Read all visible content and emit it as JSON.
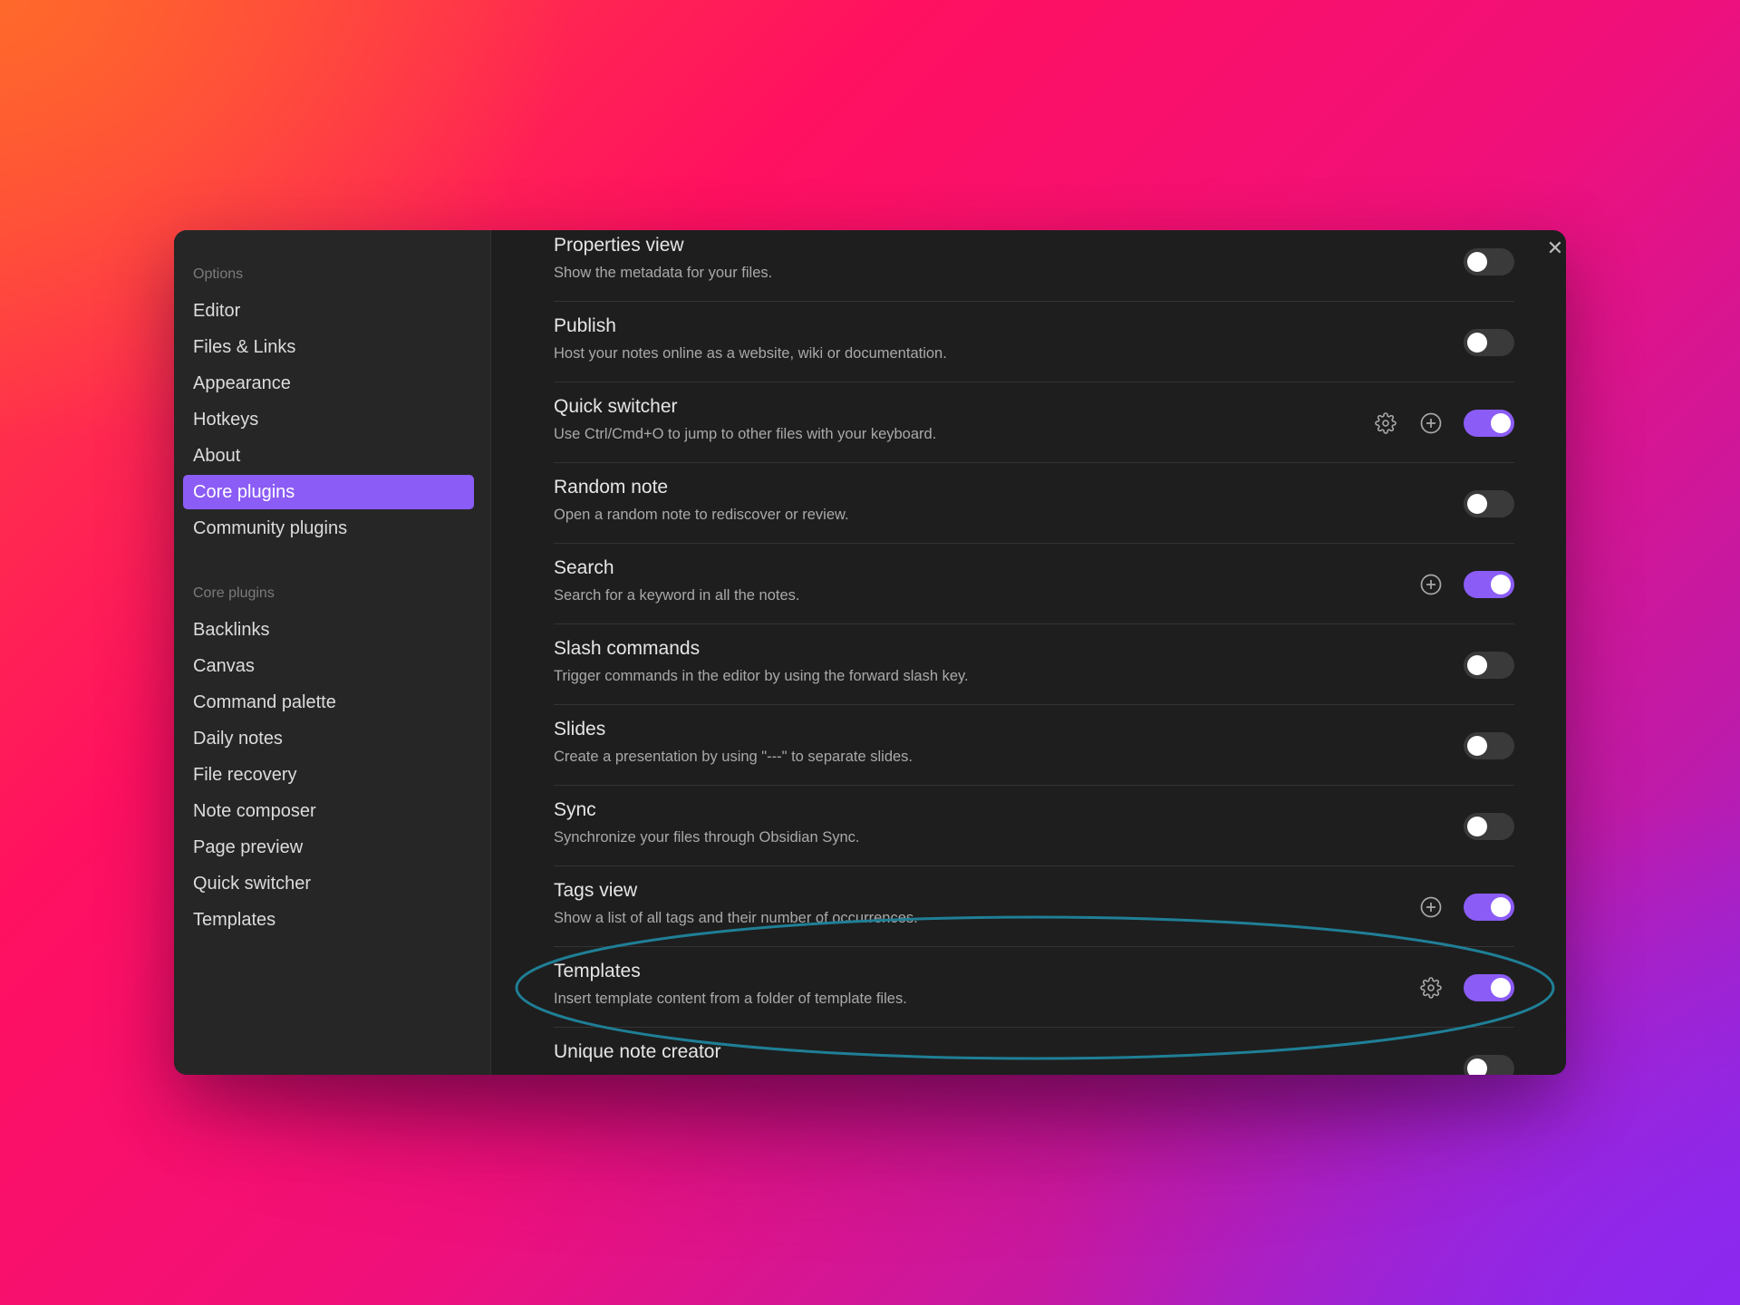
{
  "sidebar": {
    "options_heading": "Options",
    "options_items": [
      {
        "label": "Editor",
        "active": false
      },
      {
        "label": "Files & Links",
        "active": false
      },
      {
        "label": "Appearance",
        "active": false
      },
      {
        "label": "Hotkeys",
        "active": false
      },
      {
        "label": "About",
        "active": false
      },
      {
        "label": "Core plugins",
        "active": true
      },
      {
        "label": "Community plugins",
        "active": false
      }
    ],
    "core_heading": "Core plugins",
    "core_items": [
      {
        "label": "Backlinks"
      },
      {
        "label": "Canvas"
      },
      {
        "label": "Command palette"
      },
      {
        "label": "Daily notes"
      },
      {
        "label": "File recovery"
      },
      {
        "label": "Note composer"
      },
      {
        "label": "Page preview"
      },
      {
        "label": "Quick switcher"
      },
      {
        "label": "Templates"
      }
    ]
  },
  "plugins": [
    {
      "title": "Properties view",
      "description": "Show the metadata for your files.",
      "enabled": false,
      "settings": false,
      "hotkey": false
    },
    {
      "title": "Publish",
      "description": "Host your notes online as a website, wiki or documentation.",
      "enabled": false,
      "settings": false,
      "hotkey": false
    },
    {
      "title": "Quick switcher",
      "description": "Use Ctrl/Cmd+O to jump to other files with your keyboard.",
      "enabled": true,
      "settings": true,
      "hotkey": true
    },
    {
      "title": "Random note",
      "description": "Open a random note to rediscover or review.",
      "enabled": false,
      "settings": false,
      "hotkey": false
    },
    {
      "title": "Search",
      "description": "Search for a keyword in all the notes.",
      "enabled": true,
      "settings": false,
      "hotkey": true
    },
    {
      "title": "Slash commands",
      "description": "Trigger commands in the editor by using the forward slash key.",
      "enabled": false,
      "settings": false,
      "hotkey": false
    },
    {
      "title": "Slides",
      "description": "Create a presentation by using \"---\" to separate slides.",
      "enabled": false,
      "settings": false,
      "hotkey": false
    },
    {
      "title": "Sync",
      "description": "Synchronize your files through Obsidian Sync.",
      "enabled": false,
      "settings": false,
      "hotkey": false
    },
    {
      "title": "Tags view",
      "description": "Show a list of all tags and their number of occurrences.",
      "enabled": true,
      "settings": false,
      "hotkey": true
    },
    {
      "title": "Templates",
      "description": "Insert template content from a folder of template files.",
      "enabled": true,
      "settings": true,
      "hotkey": false
    },
    {
      "title": "Unique note creator",
      "description": "",
      "enabled": false,
      "settings": false,
      "hotkey": false
    }
  ],
  "close_icon": "close-icon",
  "highlight_color": "#1f7f96",
  "accent_color": "#8b5cf6"
}
